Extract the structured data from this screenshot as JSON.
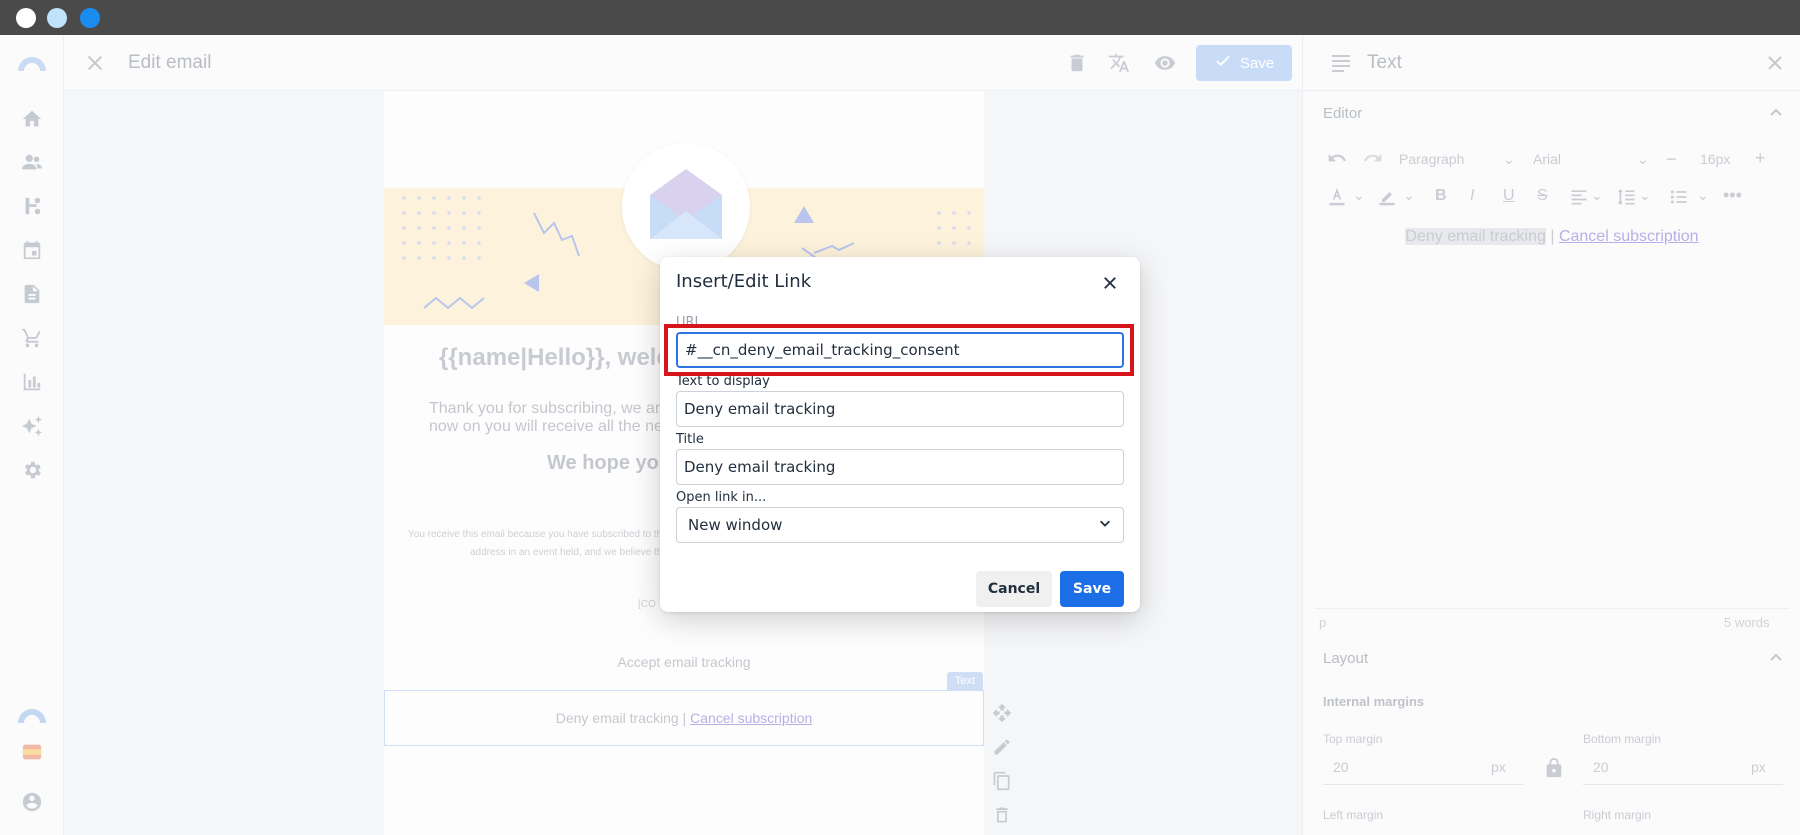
{
  "window": {
    "colors": {
      "close": "#ffffff",
      "minimize": "#bfe3fb",
      "maximize": "#1a8cf0"
    }
  },
  "header": {
    "title": "Edit email",
    "save_label": "Save",
    "icons": [
      "trash-icon",
      "translate-icon",
      "eye-icon",
      "check-icon"
    ]
  },
  "sidebar": {
    "items": [
      "home-icon",
      "users-icon",
      "flow-icon",
      "calendar-icon",
      "document-icon",
      "cart-icon",
      "chart-icon",
      "sparkle-icon",
      "gear-icon"
    ],
    "bottom": [
      "logo-icon",
      "spain-flag-icon",
      "user-icon"
    ]
  },
  "email": {
    "heading": "{{name|Hello}}, welc",
    "para_line1": "Thank you for subscribing, we are",
    "para_line2": "now on you will receive all the ne",
    "hope": "We hope you",
    "small_line1": "You receive this email because you have subscribed to th",
    "small_line2": "address in an event held, and we believe th",
    "placeholder": "[CO",
    "accept": "Accept email tracking",
    "deny": "Deny email tracking",
    "separator": " | ",
    "cancel_link": "Cancel subscription",
    "block_tag": "Text"
  },
  "right_panel": {
    "title": "Text",
    "editor_section": "Editor",
    "block_format": "Paragraph",
    "font_family": "Arial",
    "font_size": "16px",
    "editor_text_1": "Deny email tracking",
    "editor_sep": " | ",
    "editor_text_2": "Cancel subscription",
    "status_path": "p",
    "word_count": "5 words",
    "layout_section": "Layout",
    "internal_margins": "Internal margins",
    "top_margin_label": "Top margin",
    "top_margin_value": "20",
    "bottom_margin_label": "Bottom margin",
    "bottom_margin_value": "20",
    "unit": "px",
    "left_margin_label": "Left margin",
    "right_margin_label": "Right margin"
  },
  "dialog": {
    "title": "Insert/Edit Link",
    "url_label": "URL",
    "url_value": "#__cn_deny_email_tracking_consent",
    "text_label": "Text to display",
    "text_value": "Deny email tracking",
    "title_label": "Title",
    "title_value": "Deny email tracking",
    "open_label": "Open link in...",
    "open_value": "New window",
    "cancel_label": "Cancel",
    "save_label": "Save",
    "highlight_color": "#d7141c",
    "accent_color": "#1b6ee6"
  }
}
